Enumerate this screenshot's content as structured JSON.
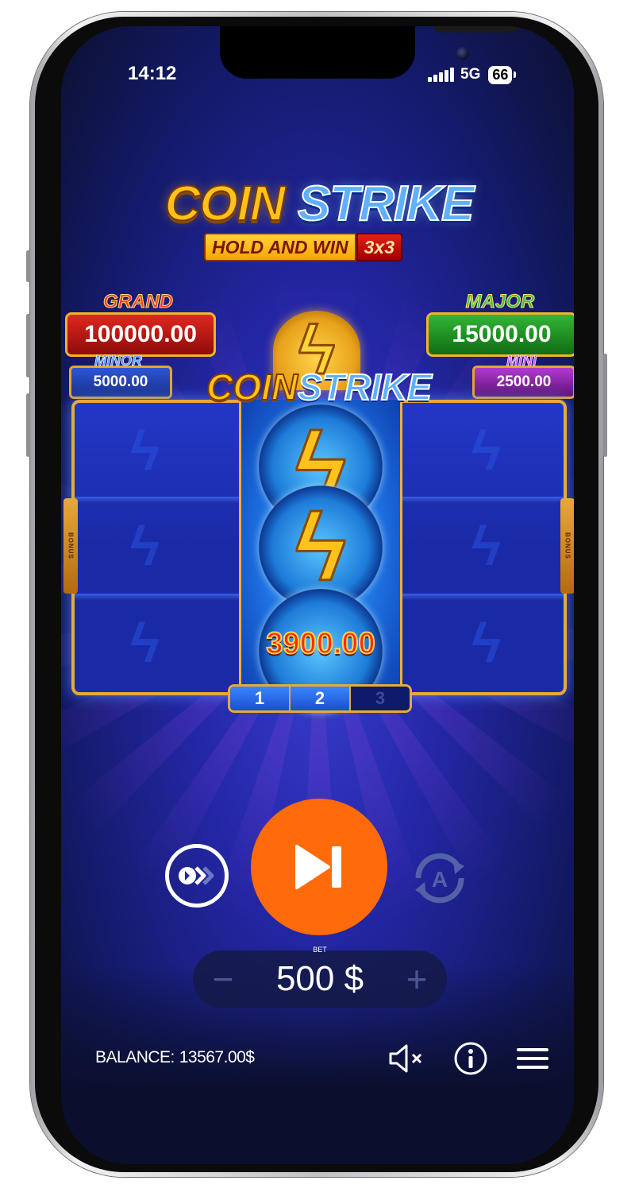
{
  "status_bar": {
    "time": "14:12",
    "network": "5G",
    "battery": "66"
  },
  "logo": {
    "word1": "COIN",
    "word2": "STRIKE",
    "subtitle": "HOLD AND WIN",
    "badge": "3x3"
  },
  "jackpots": {
    "grand": {
      "label": "GRAND",
      "value": "100000.00"
    },
    "major": {
      "label": "MAJOR",
      "value": "15000.00"
    },
    "minor": {
      "label": "MINOR",
      "value": "5000.00"
    },
    "mini": {
      "label": "MINI",
      "value": "2500.00"
    }
  },
  "reels": {
    "bonus_label": "BONUS",
    "center_logo": {
      "word1": "COIN",
      "word2": "STRIKE"
    },
    "win_value": "3900.00",
    "spin_counter": [
      "1",
      "2",
      "3"
    ],
    "active_spins": 2
  },
  "controls": {
    "bet_label": "BET",
    "bet_value": "500 $",
    "balance_label": "BALANCE:",
    "balance_value": "13567.00$"
  },
  "icons": [
    "turbo-icon",
    "skip-icon",
    "autoplay-icon",
    "sound-off-icon",
    "info-icon",
    "menu-icon",
    "minus-icon",
    "plus-icon"
  ],
  "colors": {
    "play_button": "#ff6a0a",
    "reel_frame": "#e7a93a"
  }
}
